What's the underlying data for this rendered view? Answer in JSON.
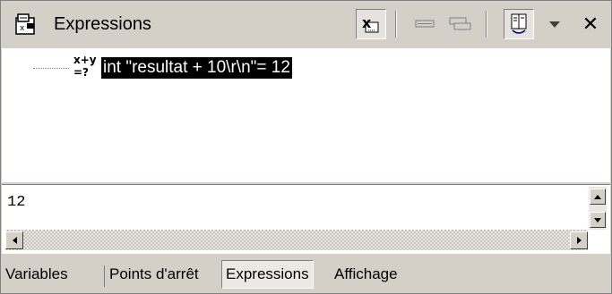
{
  "window": {
    "title": "Expressions",
    "icons": {
      "view": "expressions-view-icon",
      "toggle_display": "evaluate-icon",
      "collapse": "collapse-icon",
      "collapse_all": "collapse-all-icon",
      "detail_pane": "detail-pane-icon",
      "menu": "chevron-down-icon",
      "close": "close-icon"
    }
  },
  "tree": {
    "items": [
      {
        "label": "int \"resultat + 10\\r\\n\"= 12",
        "icon": "expression-icon",
        "icon_text": "x+y\n=?"
      }
    ]
  },
  "detail": {
    "text": "12"
  },
  "tabs": [
    {
      "label": "Variables"
    },
    {
      "label": "Points d'arrêt"
    },
    {
      "label": "Expressions",
      "active": true
    },
    {
      "label": "Affichage"
    }
  ],
  "colors": {
    "chrome": "#d4d0c8",
    "selection": "#000000",
    "content_bg": "#ffffff"
  }
}
